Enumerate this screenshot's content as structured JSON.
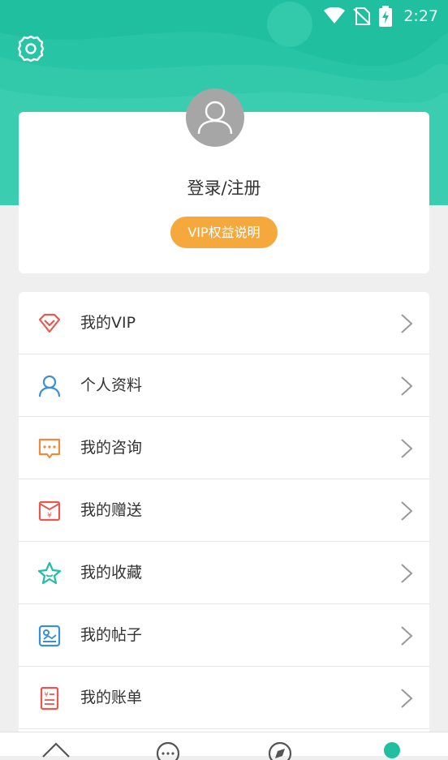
{
  "status_bar": {
    "time": "2:27"
  },
  "header": {
    "settings_icon": "gear-icon"
  },
  "profile": {
    "avatar_icon": "user-avatar-icon",
    "login_label": "登录/注册",
    "vip_button_label": "VIP权益说明"
  },
  "menu": {
    "items": [
      {
        "label": "我的VIP",
        "icon": "diamond-icon",
        "color": "#e8584f"
      },
      {
        "label": "个人资料",
        "icon": "person-icon",
        "color": "#3a8fd8"
      },
      {
        "label": "我的咨询",
        "icon": "chat-icon",
        "color": "#f08a3c"
      },
      {
        "label": "我的赠送",
        "icon": "gift-envelope-icon",
        "color": "#e8584f"
      },
      {
        "label": "我的收藏",
        "icon": "star-icon",
        "color": "#1fbf9f"
      },
      {
        "label": "我的帖子",
        "icon": "picture-icon",
        "color": "#3a8fd8"
      },
      {
        "label": "我的账单",
        "icon": "bill-icon",
        "color": "#e8584f"
      }
    ]
  },
  "tabbar": {
    "tabs": [
      {
        "icon": "home-icon"
      },
      {
        "icon": "message-icon"
      },
      {
        "icon": "discover-icon"
      },
      {
        "icon": "profile-icon",
        "active": true
      }
    ]
  },
  "colors": {
    "primary": "#1fbf9f",
    "accent": "#f5a93d",
    "background": "#efefef"
  }
}
